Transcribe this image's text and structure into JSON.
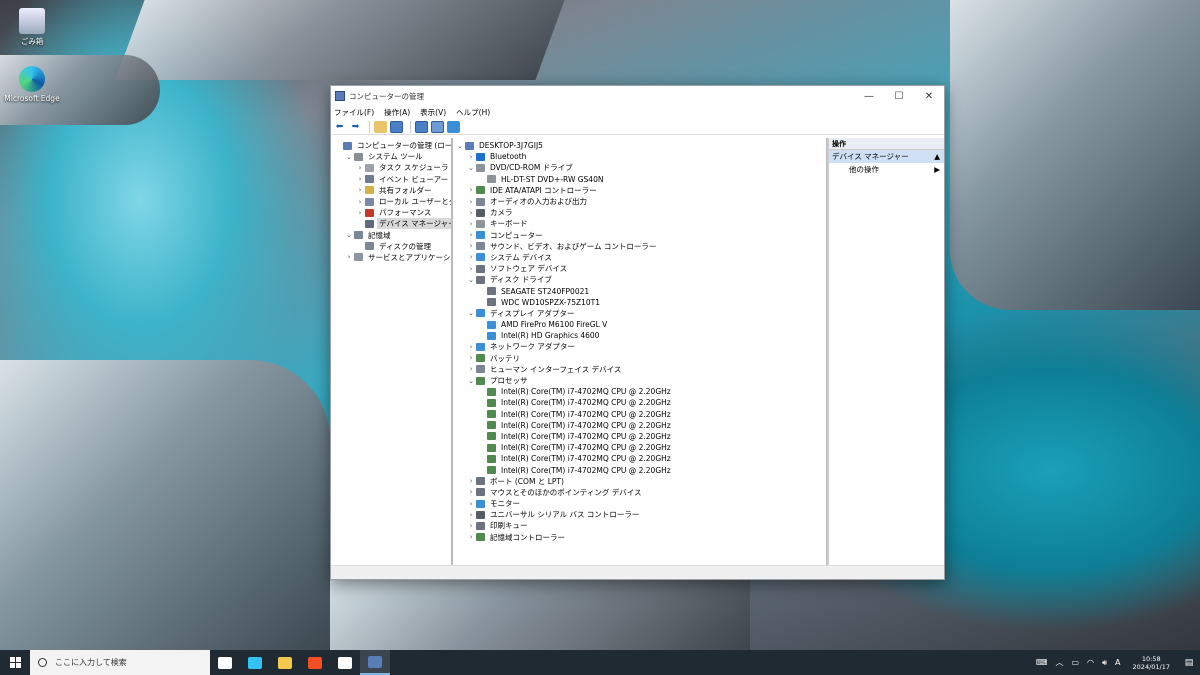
{
  "desktop": {
    "icons": [
      {
        "label": "ごみ箱"
      },
      {
        "label": "Microsoft Edge"
      }
    ]
  },
  "window": {
    "title": "コンピューターの管理",
    "controls": {
      "minimize": "—",
      "maximize": "☐",
      "close": "✕"
    },
    "menu": [
      "ファイル(F)",
      "操作(A)",
      "表示(V)",
      "ヘルプ(H)"
    ],
    "left_tree": [
      {
        "label": "コンピューターの管理 (ローカル)",
        "level": 0,
        "arrow": "",
        "icon": "computer-icon",
        "color": "#5b7db7"
      },
      {
        "label": "システム ツール",
        "level": 1,
        "arrow": "⌄",
        "icon": "tools-icon",
        "color": "#8a8f95"
      },
      {
        "label": "タスク スケジューラ",
        "level": 2,
        "arrow": "›",
        "icon": "clock-icon",
        "color": "#9aa3ad"
      },
      {
        "label": "イベント ビューアー",
        "level": 2,
        "arrow": "›",
        "icon": "event-viewer-icon",
        "color": "#6b7c93"
      },
      {
        "label": "共有フォルダー",
        "level": 2,
        "arrow": "›",
        "icon": "folder-icon",
        "color": "#d7b04a"
      },
      {
        "label": "ローカル ユーザーとグループ",
        "level": 2,
        "arrow": "›",
        "icon": "users-icon",
        "color": "#7a89a6"
      },
      {
        "label": "パフォーマンス",
        "level": 2,
        "arrow": "›",
        "icon": "performance-icon",
        "color": "#c0392b"
      },
      {
        "label": "デバイス マネージャー",
        "level": 2,
        "arrow": "",
        "icon": "device-manager-icon",
        "color": "#5f6b7a",
        "selected": true
      },
      {
        "label": "記憶域",
        "level": 1,
        "arrow": "⌄",
        "icon": "storage-icon",
        "color": "#7b8794"
      },
      {
        "label": "ディスクの管理",
        "level": 2,
        "arrow": "",
        "icon": "disk-management-icon",
        "color": "#7b8794"
      },
      {
        "label": "サービスとアプリケーション",
        "level": 1,
        "arrow": "›",
        "icon": "services-icon",
        "color": "#8c95a0"
      }
    ],
    "device_tree": [
      {
        "label": "DESKTOP-3J7GIJ5",
        "level": 0,
        "arrow": "⌄",
        "icon": "computer-icon",
        "color": "#5b7db7"
      },
      {
        "label": "Bluetooth",
        "level": 1,
        "arrow": "›",
        "icon": "bluetooth-icon",
        "color": "#1f6fd1"
      },
      {
        "label": "DVD/CD-ROM ドライブ",
        "level": 1,
        "arrow": "⌄",
        "icon": "dvd-drive-icon",
        "color": "#8d949c"
      },
      {
        "label": "HL-DT-ST DVD+-RW GS40N",
        "level": 2,
        "arrow": "",
        "icon": "dvd-drive-icon",
        "color": "#8d949c"
      },
      {
        "label": "IDE ATA/ATAPI コントローラー",
        "level": 1,
        "arrow": "›",
        "icon": "ide-controller-icon",
        "color": "#4f8a4f"
      },
      {
        "label": "オーディオの入力および出力",
        "level": 1,
        "arrow": "›",
        "icon": "audio-icon",
        "color": "#7b8794"
      },
      {
        "label": "カメラ",
        "level": 1,
        "arrow": "›",
        "icon": "camera-icon",
        "color": "#555d66"
      },
      {
        "label": "キーボード",
        "level": 1,
        "arrow": "›",
        "icon": "keyboard-icon",
        "color": "#8d949c"
      },
      {
        "label": "コンピューター",
        "level": 1,
        "arrow": "›",
        "icon": "computer-icon",
        "color": "#3b8fd6"
      },
      {
        "label": "サウンド、ビデオ、およびゲーム コントローラー",
        "level": 1,
        "arrow": "›",
        "icon": "sound-icon",
        "color": "#7b8794"
      },
      {
        "label": "システム デバイス",
        "level": 1,
        "arrow": "›",
        "icon": "system-device-icon",
        "color": "#3b8fd6"
      },
      {
        "label": "ソフトウェア デバイス",
        "level": 1,
        "arrow": "›",
        "icon": "software-device-icon",
        "color": "#6b7280"
      },
      {
        "label": "ディスク ドライブ",
        "level": 1,
        "arrow": "⌄",
        "icon": "disk-drive-icon",
        "color": "#6b7280"
      },
      {
        "label": "SEAGATE ST240FP0021",
        "level": 2,
        "arrow": "",
        "icon": "disk-drive-icon",
        "color": "#6b7280"
      },
      {
        "label": "WDC WD10SPZX-75Z10T1",
        "level": 2,
        "arrow": "",
        "icon": "disk-drive-icon",
        "color": "#6b7280"
      },
      {
        "label": "ディスプレイ アダプター",
        "level": 1,
        "arrow": "⌄",
        "icon": "display-adapter-icon",
        "color": "#3b8fd6"
      },
      {
        "label": "AMD FirePro M6100 FireGL V",
        "level": 2,
        "arrow": "",
        "icon": "display-adapter-icon",
        "color": "#3b8fd6"
      },
      {
        "label": "Intel(R) HD Graphics 4600",
        "level": 2,
        "arrow": "",
        "icon": "display-adapter-icon",
        "color": "#3b8fd6"
      },
      {
        "label": "ネットワーク アダプター",
        "level": 1,
        "arrow": "›",
        "icon": "network-adapter-icon",
        "color": "#3b8fd6"
      },
      {
        "label": "バッテリ",
        "level": 1,
        "arrow": "›",
        "icon": "battery-icon",
        "color": "#4f8a4f"
      },
      {
        "label": "ヒューマン インターフェイス デバイス",
        "level": 1,
        "arrow": "›",
        "icon": "hid-icon",
        "color": "#7b8794"
      },
      {
        "label": "プロセッサ",
        "level": 1,
        "arrow": "⌄",
        "icon": "processor-icon",
        "color": "#4f8a4f"
      },
      {
        "label": "Intel(R) Core(TM) i7-4702MQ CPU @ 2.20GHz",
        "level": 2,
        "arrow": "",
        "icon": "processor-icon",
        "color": "#4f8a4f"
      },
      {
        "label": "Intel(R) Core(TM) i7-4702MQ CPU @ 2.20GHz",
        "level": 2,
        "arrow": "",
        "icon": "processor-icon",
        "color": "#4f8a4f"
      },
      {
        "label": "Intel(R) Core(TM) i7-4702MQ CPU @ 2.20GHz",
        "level": 2,
        "arrow": "",
        "icon": "processor-icon",
        "color": "#4f8a4f"
      },
      {
        "label": "Intel(R) Core(TM) i7-4702MQ CPU @ 2.20GHz",
        "level": 2,
        "arrow": "",
        "icon": "processor-icon",
        "color": "#4f8a4f"
      },
      {
        "label": "Intel(R) Core(TM) i7-4702MQ CPU @ 2.20GHz",
        "level": 2,
        "arrow": "",
        "icon": "processor-icon",
        "color": "#4f8a4f"
      },
      {
        "label": "Intel(R) Core(TM) i7-4702MQ CPU @ 2.20GHz",
        "level": 2,
        "arrow": "",
        "icon": "processor-icon",
        "color": "#4f8a4f"
      },
      {
        "label": "Intel(R) Core(TM) i7-4702MQ CPU @ 2.20GHz",
        "level": 2,
        "arrow": "",
        "icon": "processor-icon",
        "color": "#4f8a4f"
      },
      {
        "label": "Intel(R) Core(TM) i7-4702MQ CPU @ 2.20GHz",
        "level": 2,
        "arrow": "",
        "icon": "processor-icon",
        "color": "#4f8a4f"
      },
      {
        "label": "ポート (COM と LPT)",
        "level": 1,
        "arrow": "›",
        "icon": "port-icon",
        "color": "#6b7280"
      },
      {
        "label": "マウスとそのほかのポインティング デバイス",
        "level": 1,
        "arrow": "›",
        "icon": "mouse-icon",
        "color": "#6b7280"
      },
      {
        "label": "モニター",
        "level": 1,
        "arrow": "›",
        "icon": "monitor-icon",
        "color": "#3b8fd6"
      },
      {
        "label": "ユニバーサル シリアル バス コントローラー",
        "level": 1,
        "arrow": "›",
        "icon": "usb-icon",
        "color": "#555d66"
      },
      {
        "label": "印刷キュー",
        "level": 1,
        "arrow": "›",
        "icon": "printer-icon",
        "color": "#6b7280"
      },
      {
        "label": "記憶域コントローラー",
        "level": 1,
        "arrow": "›",
        "icon": "storage-controller-icon",
        "color": "#4f8a4f"
      }
    ],
    "actions_pane": {
      "header": "操作",
      "section": "デバイス マネージャー",
      "items": [
        "他の操作"
      ]
    }
  },
  "taskbar": {
    "search_placeholder": "ここに入力して検索",
    "apps": [
      {
        "name": "task-view-icon",
        "color": "#ffffff"
      },
      {
        "name": "edge-icon",
        "color": "#35c1f1"
      },
      {
        "name": "file-explorer-icon",
        "color": "#f2c94c"
      },
      {
        "name": "store-icon",
        "color": "#f25022"
      },
      {
        "name": "mail-icon",
        "color": "#ffffff"
      },
      {
        "name": "computer-management-icon",
        "color": "#5b7db7"
      }
    ],
    "ime": "A",
    "time": "10:58",
    "date": "2024/01/17"
  }
}
